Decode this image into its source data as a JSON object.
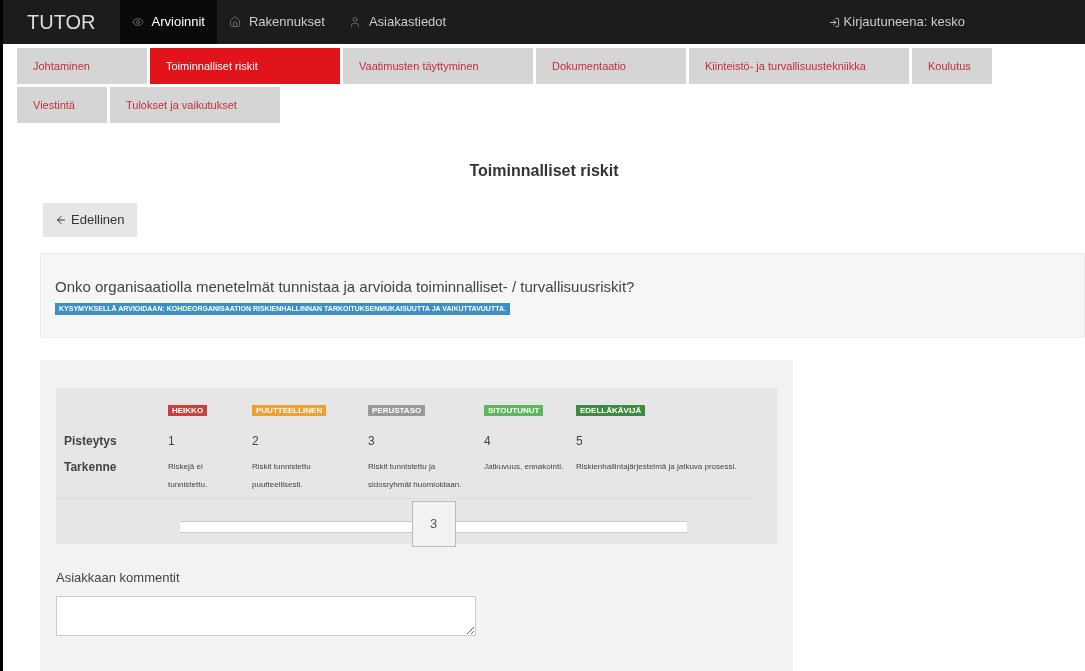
{
  "navbar": {
    "brand": "TUTOR",
    "items": [
      {
        "label": "Arvioinnit",
        "selected": true
      },
      {
        "label": "Rakennukset",
        "selected": false
      },
      {
        "label": "Asiakastiedot",
        "selected": false
      }
    ],
    "login": "Kirjautuneena: kesko"
  },
  "tabs": [
    {
      "label": "Johtaminen",
      "selected": false
    },
    {
      "label": "Toiminnalliset riskit",
      "selected": true
    },
    {
      "label": "Vaatimusten täyttyminen",
      "selected": false
    },
    {
      "label": "Dokumentaatio",
      "selected": false
    },
    {
      "label": "Kiinteistö- ja turvallisuustekniikka",
      "selected": false
    },
    {
      "label": "Koulutus",
      "selected": false
    },
    {
      "label": "Viestintä",
      "selected": false
    },
    {
      "label": "Tulokset ja vaikutukset",
      "selected": false
    }
  ],
  "page_title": "Toiminnalliset riskit",
  "back_button": "Edellinen",
  "question": {
    "text": "Onko organisaatiolla menetelmät tunnistaa ja arvioida toiminnalliset- / turvallisuusriskit?",
    "tag": "KYSYMYKSELLÄ ARVIOIDAAN: KOHDEORGANISAATION RISKIENHALLINNAN TARKOITUKSENMUKAISUUTTA JA VAIKUTTAVUUTTA."
  },
  "scale": {
    "row_labels": [
      "Pisteytys",
      "Tarkenne"
    ],
    "levels": [
      {
        "badge": "HEIKKO",
        "color": "#c9403c",
        "score": "1",
        "description": "Riskejä ei tunnistettu."
      },
      {
        "badge": "PUUTTEELLINEN",
        "color": "#f0a032",
        "score": "2",
        "description": "Riskit tunnistettu puutteellisesti."
      },
      {
        "badge": "PERUSTASO",
        "color": "#999999",
        "score": "3",
        "description": "Riskit tunnistettu ja sidosryhmät huomioidaan."
      },
      {
        "badge": "SITOUTUNUT",
        "color": "#5cb85c",
        "score": "4",
        "description": "Jatkuvuus, ennakointi."
      },
      {
        "badge": "EDELLÄKÄVIJÄ",
        "color": "#3d8b3d",
        "score": "5",
        "description": "Riskienhallintajärjestelmä ja jatkuva prosessi."
      }
    ],
    "slider": {
      "level": 0.5,
      "value": "3"
    }
  },
  "comments": {
    "label": "Asiakkaan kommentit"
  }
}
